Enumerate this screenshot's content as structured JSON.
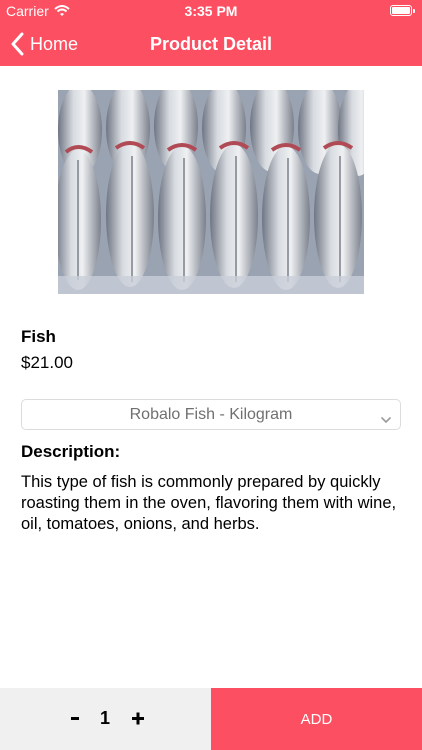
{
  "status_bar": {
    "carrier": "Carrier",
    "time": "3:35 PM"
  },
  "nav": {
    "back_label": "Home",
    "title": "Product Detail"
  },
  "product": {
    "name": "Fish",
    "price": "$21.00",
    "variant_selected": "Robalo Fish - Kilogram",
    "description_label": "Description:",
    "description": "This type of fish is commonly prepared by quickly roasting them in the oven, flavoring them with wine, oil, tomatoes, onions, and herbs."
  },
  "cart": {
    "quantity": "1",
    "add_label": "ADD"
  },
  "colors": {
    "accent": "#fc4f61",
    "bottom_left_bg": "#f0f0f0"
  },
  "icons": {
    "back": "chevron-left-icon",
    "dropdown": "chevron-down-icon",
    "minus": "minus-icon",
    "plus": "plus-icon",
    "wifi": "wifi-icon",
    "battery": "battery-icon"
  }
}
